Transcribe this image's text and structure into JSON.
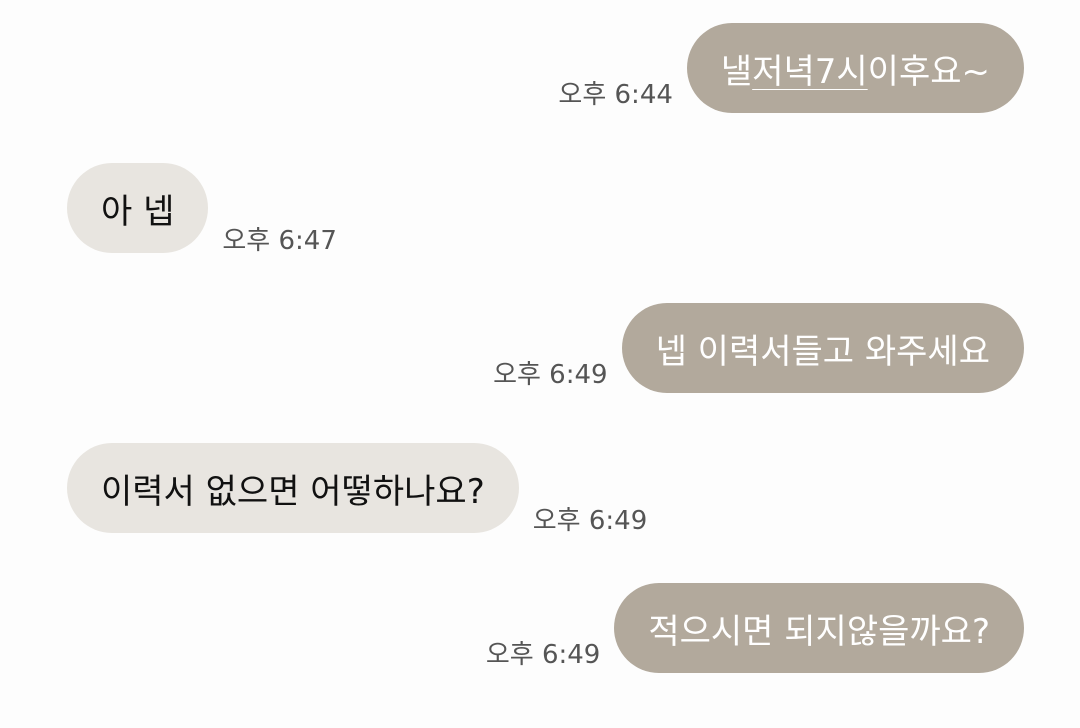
{
  "messages": [
    {
      "direction": "out",
      "text_before": "낼",
      "text_underlined": "저녁7시",
      "text_after": "이후요~",
      "time": "오후 6:44"
    },
    {
      "direction": "in",
      "text": "아 넵",
      "time": "오후 6:47"
    },
    {
      "direction": "out",
      "text": "넵 이력서들고 와주세요",
      "time": "오후 6:49"
    },
    {
      "direction": "in",
      "text": "이력서 없으면 어떻하나요?",
      "time": "오후 6:49"
    },
    {
      "direction": "out",
      "text": "적으시면 되지않을까요?",
      "time": "오후 6:49"
    }
  ],
  "colors": {
    "outgoing_bubble": "#b2a99c",
    "incoming_bubble": "#e8e5e0",
    "background": "#fdfdfd"
  }
}
